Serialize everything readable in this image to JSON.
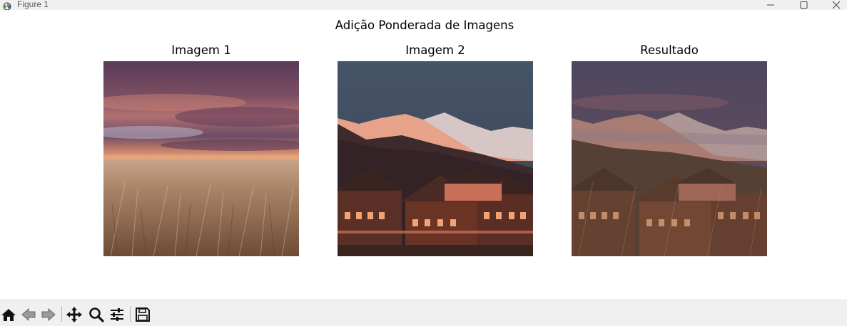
{
  "window": {
    "title": "Figure 1",
    "icons": [
      "matplotlib-app-icon",
      "minimize-icon",
      "maximize-icon",
      "close-icon"
    ]
  },
  "figure": {
    "suptitle": "Adição Ponderada de Imagens",
    "panels": [
      {
        "title": "Imagem 1",
        "content": "wheat-field-sunset-photo"
      },
      {
        "title": "Imagem 2",
        "content": "mountain-village-dusk-photo"
      },
      {
        "title": "Resultado",
        "content": "weighted-blend-photo"
      }
    ]
  },
  "toolbar": {
    "buttons": [
      "home-icon",
      "back-icon",
      "forward-icon",
      "pan-icon",
      "zoom-icon",
      "configure-subplots-icon",
      "save-icon"
    ]
  }
}
